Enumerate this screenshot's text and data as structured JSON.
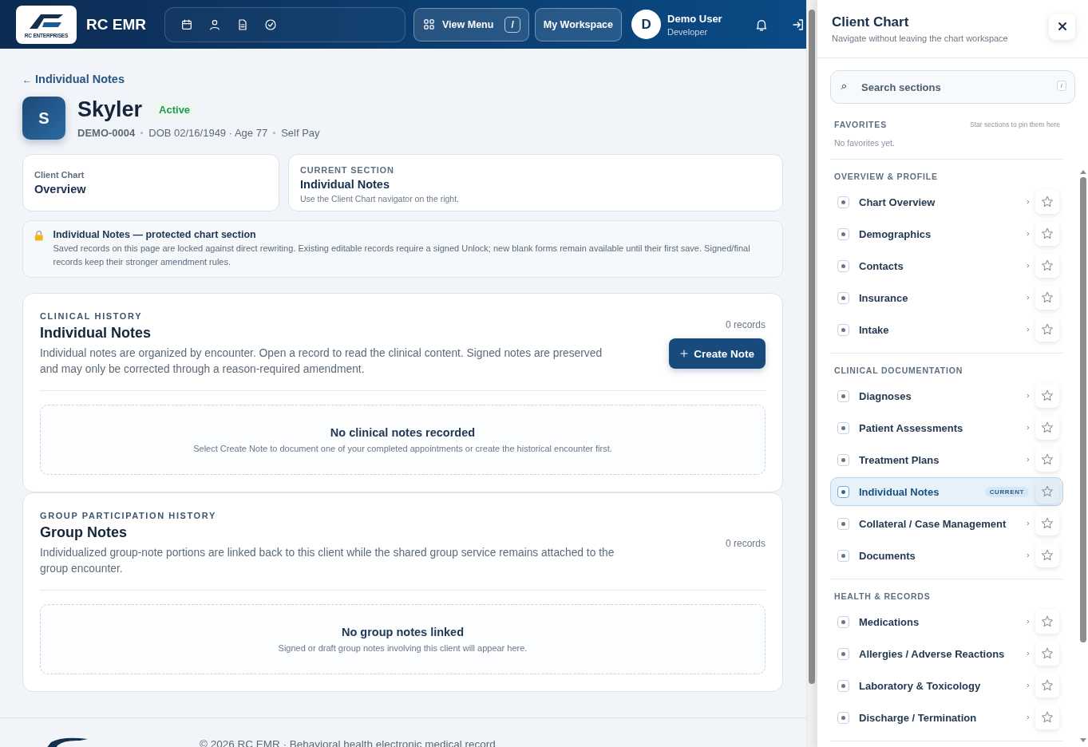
{
  "header": {
    "logo_text": "RC ENTERPRISES",
    "app_name": "RC EMR",
    "view_menu": {
      "label": "View Menu",
      "shortcut": "/"
    },
    "workspace": "My Workspace",
    "user": {
      "initial": "D",
      "name": "Demo User",
      "role": "Developer"
    }
  },
  "back_link": {
    "arrow": "←",
    "label": "Individual Notes"
  },
  "client": {
    "initial": "S",
    "name": "Skyler",
    "status": "Active",
    "id": "DEMO-0004",
    "dob": "DOB 02/16/1949 · Age 77",
    "payer": "Self Pay"
  },
  "cards": [
    {
      "label": "Client Chart",
      "value": "Overview"
    },
    {
      "label": "CURRENT SECTION",
      "value": "Individual Notes",
      "hint": "Use the Client Chart navigator on the right."
    }
  ],
  "notice": {
    "title": "Individual Notes — protected chart section",
    "text": "Saved records on this page are locked against direct rewriting. Existing editable records require a signed Unlock; new blank forms remain available until their first save. Signed/final records keep their stronger amendment rules."
  },
  "sections": [
    {
      "eyebrow": "CLINICAL HISTORY",
      "title": "Individual Notes",
      "description": "Individual notes are organized by encounter. Open a record to read the clinical content. Signed notes are preserved and may only be corrected through a reason-required amendment.",
      "count": "0 records",
      "button": "Create Note",
      "empty": {
        "title": "No clinical notes recorded",
        "text": "Select Create Note to document one of your completed appointments or create the historical encounter first."
      }
    },
    {
      "eyebrow": "GROUP PARTICIPATION HISTORY",
      "title": "Group Notes",
      "description": "Individualized group-note portions are linked back to this client while the shared group service remains attached to the group encounter.",
      "count": "0 records",
      "empty": {
        "title": "No group notes linked",
        "text": "Signed or draft group notes involving this client will appear here."
      }
    }
  ],
  "footer": {
    "copyright": "© 2026 RC EMR · Behavioral health electronic medical record"
  },
  "panel": {
    "title": "Client Chart",
    "subtitle": "Navigate without leaving the chart workspace",
    "search": {
      "placeholder": "Search sections",
      "shortcut": "/"
    },
    "favorites": {
      "heading": "FAVORITES",
      "hint": "Star sections to pin them here",
      "empty": "No favorites yet."
    },
    "groups": [
      {
        "heading": "OVERVIEW & PROFILE",
        "items": [
          {
            "label": "Chart Overview",
            "selected": false
          },
          {
            "label": "Demographics",
            "selected": false
          },
          {
            "label": "Contacts",
            "selected": false
          },
          {
            "label": "Insurance",
            "selected": false
          },
          {
            "label": "Intake",
            "selected": false
          }
        ]
      },
      {
        "heading": "CLINICAL DOCUMENTATION",
        "items": [
          {
            "label": "Diagnoses",
            "selected": false
          },
          {
            "label": "Patient Assessments",
            "selected": false
          },
          {
            "label": "Treatment Plans",
            "selected": false
          },
          {
            "label": "Individual Notes",
            "selected": true,
            "badge": "CURRENT"
          },
          {
            "label": "Collateral / Case Management",
            "selected": false
          },
          {
            "label": "Documents",
            "selected": false
          }
        ]
      },
      {
        "heading": "HEALTH & RECORDS",
        "items": [
          {
            "label": "Medications",
            "selected": false
          },
          {
            "label": "Allergies / Adverse Reactions",
            "selected": false
          },
          {
            "label": "Laboratory & Toxicology",
            "selected": false
          },
          {
            "label": "Discharge / Termination",
            "selected": false
          }
        ]
      }
    ]
  }
}
